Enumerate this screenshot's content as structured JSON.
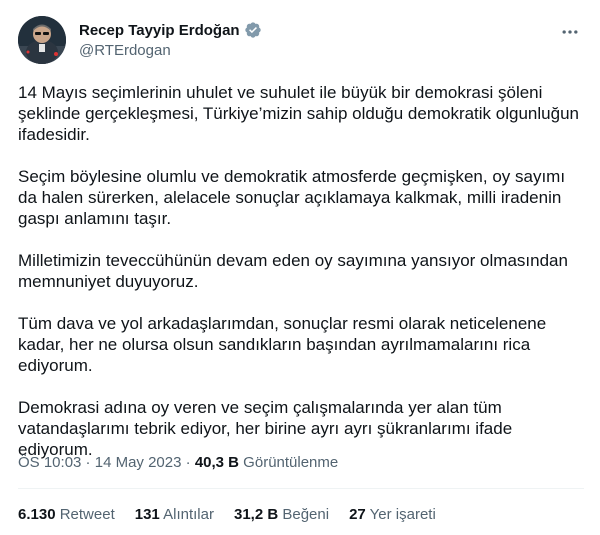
{
  "author": {
    "display_name": "Recep Tayyip Erdoğan",
    "handle": "@RTErdogan",
    "verified_badge_color": "#829aab"
  },
  "tweet": {
    "paragraphs": [
      "14 Mayıs seçimlerinin uhulet ve suhulet ile büyük bir demokrasi şöleni şeklinde gerçekleşmesi, Türkiye’mizin sahip olduğu demokratik olgunluğun ifadesidir.",
      "Seçim böylesine olumlu ve demokratik atmosferde geçmişken, oy sayımı da halen sürerken, alelacele sonuçlar açıklamaya kalkmak, milli iradenin gaspı anlamını taşır.",
      "Milletimizin teveccühünün devam eden oy sayımına yansıyor olmasından memnuniyet duyuyoruz.",
      "Tüm dava ve yol arkadaşlarımdan, sonuçlar resmi olarak neticelenene kadar, her ne olursa olsun sandıkların başından ayrılmamalarını rica ediyorum.",
      "Demokrasi adına oy veren ve seçim çalışmalarında yer alan tüm vatandaşlarımı tebrik ediyor, her birine ayrı ayrı şükranlarımı ifade ediyorum."
    ]
  },
  "meta": {
    "time": "ÖS 10:03",
    "separator": " · ",
    "date": "14 May 2023",
    "views_count": "40,3 B",
    "views_label": " Görüntülenme"
  },
  "stats": {
    "retweets": {
      "count": "6.130",
      "label": " Retweet"
    },
    "quotes": {
      "count": "131",
      "label": " Alıntılar"
    },
    "likes": {
      "count": "31,2 B",
      "label": " Beğeni"
    },
    "bookmarks": {
      "count": "27",
      "label": " Yer işareti"
    }
  },
  "icons": {
    "more": "more-horizontal-icon",
    "verified": "verified-badge-icon"
  }
}
